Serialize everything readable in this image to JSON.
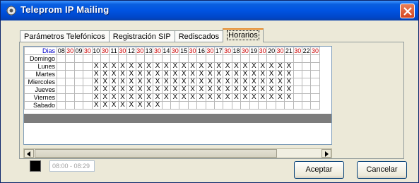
{
  "window": {
    "title": "Teleprom IP Mailing"
  },
  "tabs": [
    {
      "label": "Parámetros Telefónicos",
      "active": false
    },
    {
      "label": "Registración SIP",
      "active": false
    },
    {
      "label": "Rediscados",
      "active": false
    },
    {
      "label": "Horarios",
      "active": true
    }
  ],
  "schedule": {
    "corner_label": "Dias",
    "column_labels": [
      "08",
      "30",
      "09",
      "30",
      "10",
      "30",
      "11",
      "30",
      "12",
      "30",
      "13",
      "30",
      "14",
      "30",
      "15",
      "30",
      "16",
      "30",
      "17",
      "30",
      "18",
      "30",
      "19",
      "30",
      "20",
      "30",
      "21",
      "30",
      "22",
      "30"
    ],
    "rows": [
      {
        "day": "Domingo",
        "cells": [
          "",
          "",
          "",
          "",
          "",
          "",
          "",
          "",
          "",
          "",
          "",
          "",
          "",
          "",
          "",
          "",
          "",
          "",
          "",
          "",
          "",
          "",
          "",
          "",
          "",
          "",
          "",
          "",
          "",
          ""
        ]
      },
      {
        "day": "Lunes",
        "cells": [
          "",
          "",
          "",
          "",
          "X",
          "X",
          "X",
          "X",
          "X",
          "X",
          "X",
          "X",
          "X",
          "X",
          "X",
          "X",
          "X",
          "X",
          "X",
          "X",
          "X",
          "X",
          "X",
          "X",
          "X",
          "X",
          "X",
          "",
          "",
          ""
        ]
      },
      {
        "day": "Martes",
        "cells": [
          "",
          "",
          "",
          "",
          "X",
          "X",
          "X",
          "X",
          "X",
          "X",
          "X",
          "X",
          "X",
          "X",
          "X",
          "X",
          "X",
          "X",
          "X",
          "X",
          "X",
          "X",
          "X",
          "X",
          "X",
          "X",
          "X",
          "",
          "",
          ""
        ]
      },
      {
        "day": "Miercoles",
        "cells": [
          "",
          "",
          "",
          "",
          "X",
          "X",
          "X",
          "X",
          "X",
          "X",
          "X",
          "X",
          "X",
          "X",
          "X",
          "X",
          "X",
          "X",
          "X",
          "X",
          "X",
          "X",
          "X",
          "X",
          "X",
          "X",
          "X",
          "",
          "",
          ""
        ]
      },
      {
        "day": "Jueves",
        "cells": [
          "",
          "",
          "",
          "",
          "X",
          "X",
          "X",
          "X",
          "X",
          "X",
          "X",
          "X",
          "X",
          "X",
          "X",
          "X",
          "X",
          "X",
          "X",
          "X",
          "X",
          "X",
          "X",
          "X",
          "X",
          "X",
          "X",
          "",
          "",
          ""
        ]
      },
      {
        "day": "Viernes",
        "cells": [
          "",
          "",
          "",
          "",
          "X",
          "X",
          "X",
          "X",
          "X",
          "X",
          "X",
          "X",
          "X",
          "X",
          "X",
          "X",
          "X",
          "X",
          "X",
          "X",
          "X",
          "X",
          "X",
          "X",
          "X",
          "X",
          "X",
          "",
          "",
          ""
        ]
      },
      {
        "day": "Sabado",
        "cells": [
          "",
          "",
          "",
          "",
          "X",
          "X",
          "X",
          "X",
          "X",
          "X",
          "X",
          "X",
          "",
          "",
          "",
          "",
          "",
          "",
          "",
          "",
          "",
          "",
          "",
          "",
          "",
          "",
          "",
          "",
          "",
          ""
        ]
      }
    ]
  },
  "time_range": {
    "value": "08:00 - 08:29"
  },
  "buttons": {
    "accept": "Aceptar",
    "cancel": "Cancelar"
  },
  "colors": {
    "selected_color": "#000000",
    "half_hour_label": "#cc0000",
    "corner_label": "#0000cc"
  }
}
